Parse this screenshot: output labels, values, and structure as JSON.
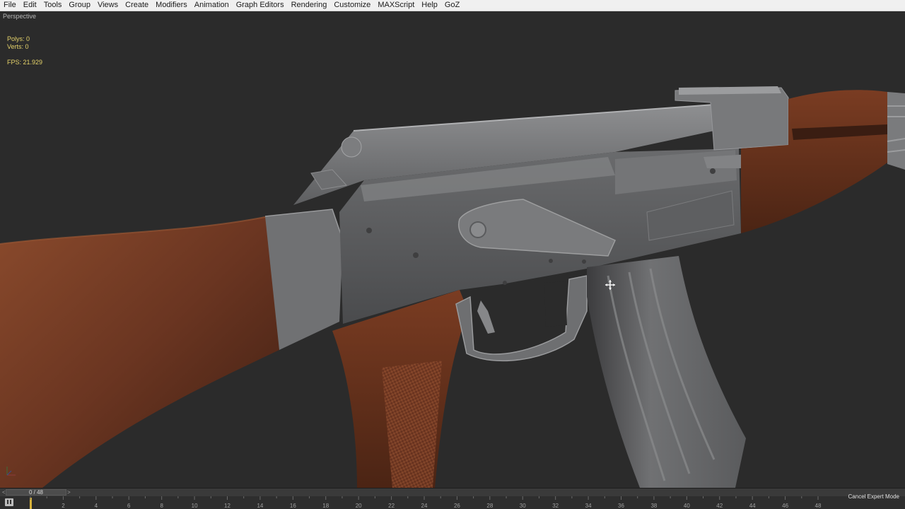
{
  "menu": [
    "File",
    "Edit",
    "Tools",
    "Group",
    "Views",
    "Create",
    "Modifiers",
    "Animation",
    "Graph Editors",
    "Rendering",
    "Customize",
    "MAXScript",
    "Help",
    "GoZ"
  ],
  "viewport": {
    "label": "Perspective",
    "polys": "Polys:  0",
    "verts": "Verts:  0",
    "fps": "FPS:   21.929"
  },
  "timeline": {
    "prev": "<",
    "next": ">",
    "frame": "0 / 48",
    "ticks": [
      "2",
      "4",
      "6",
      "8",
      "10",
      "12",
      "14",
      "16",
      "18",
      "20",
      "22",
      "24",
      "26",
      "28",
      "30",
      "32",
      "34",
      "36",
      "38",
      "40",
      "42",
      "44",
      "46",
      "48"
    ],
    "cancel_expert_mode": "Cancel Expert Mode"
  },
  "colors": {
    "menu_bg": "#f0f0f0",
    "viewport_bg": "#2b2b2b",
    "stats_text": "#e6d36a",
    "metal": "#6f6f70",
    "wood": "#6e3a24",
    "frame_marker": "#d9b33b"
  },
  "icons": [
    "move-cursor-icon",
    "axis-gizmo-icon",
    "key-mode-icon"
  ]
}
